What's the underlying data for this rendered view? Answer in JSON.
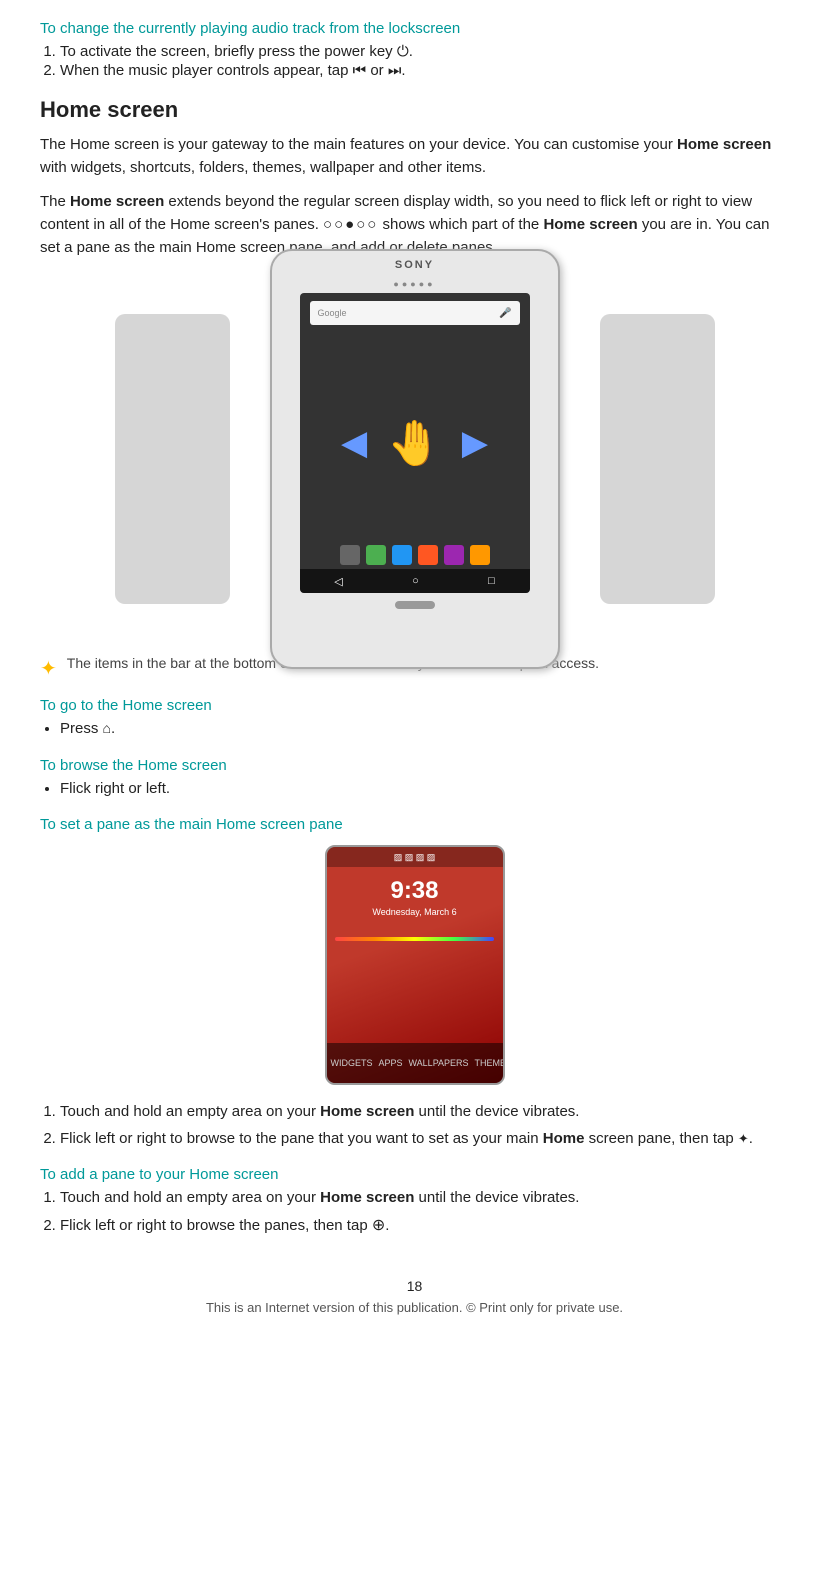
{
  "top": {
    "teal_link": "To change the currently playing audio track from the lockscreen",
    "steps": [
      "To activate the screen, briefly press the power key ⏻.",
      "When the music player controls appear, tap ⏮ or ⏭."
    ]
  },
  "home_screen": {
    "title": "Home screen",
    "para1": "The Home screen is your gateway to the main features on your device. You can customise your Home screen with widgets, shortcuts, folders, themes, wallpaper and other items.",
    "para1_bold": "Home screen",
    "para2_start": "The ",
    "para2_bold": "Home screen",
    "para2_rest": " extends beyond the regular screen display width, so you need to flick left or right to view content in all of the Home screen’s panes. ◦◦●◦◦ shows which part of the ",
    "para2_bold2": "Home screen",
    "para2_end": " you are in. You can set a pane as the main Home screen pane, and add or delete panes.",
    "tip": "The items in the bar at the bottom of the screen are always available for quick access.",
    "go_home_heading": "To go to the Home screen",
    "go_home_bullet": "Press 🏠.",
    "browse_home_heading": "To browse the Home screen",
    "browse_home_bullet": "Flick right or left.",
    "set_pane_heading": "To set a pane as the main Home screen pane",
    "set_pane_steps": [
      "Touch and hold an empty area on your Home screen until the device vibrates.",
      "Flick left or right to browse to the pane that you want to set as your main Home screen pane, then tap ✪."
    ],
    "set_pane_step1_bold": "Home screen",
    "set_pane_step2_bold": "Home",
    "add_pane_heading": "To add a pane to your Home screen",
    "add_pane_steps": [
      "Touch and hold an empty area on your Home screen until the device vibrates.",
      "Flick left or right to browse the panes, then tap ⊕."
    ],
    "add_pane_step1_bold": "Home screen",
    "device_image_alt": "Sony device showing Home screen with swipe gesture",
    "second_device_time": "9:38",
    "second_device_date": "Wednesday, March 6"
  },
  "footer": {
    "page_number": "18",
    "footer_text": "This is an Internet version of this publication. © Print only for private use."
  }
}
